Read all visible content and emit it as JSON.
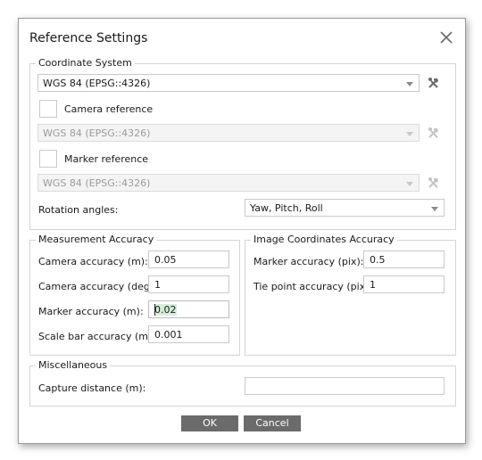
{
  "dialog": {
    "title": "Reference Settings"
  },
  "coordinate_system": {
    "legend": "Coordinate System",
    "crs_value": "WGS 84 (EPSG::4326)",
    "camera_reference_label": "Camera reference",
    "camera_crs_value": "WGS 84 (EPSG::4326)",
    "marker_reference_label": "Marker reference",
    "marker_crs_value": "WGS 84 (EPSG::4326)",
    "rotation_label": "Rotation angles:",
    "rotation_value": "Yaw, Pitch, Roll"
  },
  "measurement_accuracy": {
    "legend": "Measurement Accuracy",
    "camera_accuracy_m_label": "Camera accuracy (m):",
    "camera_accuracy_m_value": "0.05",
    "camera_accuracy_deg_label": "Camera accuracy (deg):",
    "camera_accuracy_deg_value": "1",
    "marker_accuracy_m_label": "Marker accuracy (m):",
    "marker_accuracy_m_value": "0.02",
    "scale_bar_accuracy_label": "Scale bar accuracy (m):",
    "scale_bar_accuracy_value": "0.001"
  },
  "image_accuracy": {
    "legend": "Image Coordinates Accuracy",
    "marker_accuracy_pix_label": "Marker accuracy (pix):",
    "marker_accuracy_pix_value": "0.5",
    "tie_point_accuracy_label": "Tie point accuracy (pix):",
    "tie_point_accuracy_value": "1"
  },
  "misc": {
    "legend": "Miscellaneous",
    "capture_distance_label": "Capture distance (m):",
    "capture_distance_value": ""
  },
  "buttons": {
    "ok": "OK",
    "cancel": "Cancel"
  },
  "icons": {
    "close": "close-icon",
    "tool": "wrench-hammer-icon"
  },
  "colors": {
    "button_bg": "#6b6b6b",
    "border": "#c9c9c9",
    "disabled_text": "#9a9a9a"
  }
}
